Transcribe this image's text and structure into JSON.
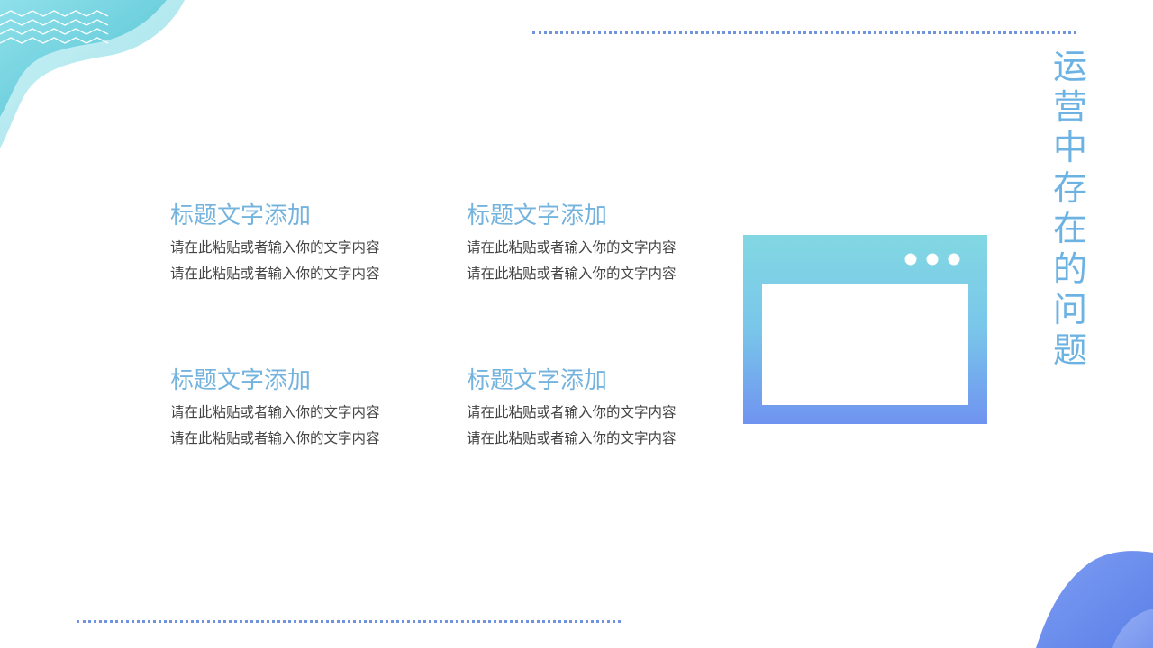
{
  "slide": {
    "vertical_title_chars": [
      "运",
      "营",
      "中",
      "存",
      "在",
      "的",
      "问",
      "题"
    ],
    "blocks": [
      {
        "title": "标题文字添加",
        "lines": [
          "请在此粘贴或者输入你的文字内容",
          "请在此粘贴或者输入你的文字内容"
        ]
      },
      {
        "title": "标题文字添加",
        "lines": [
          "请在此粘贴或者输入你的文字内容",
          "请在此粘贴或者输入你的文字内容"
        ]
      },
      {
        "title": "标题文字添加",
        "lines": [
          "请在此粘贴或者输入你的文字内容",
          "请在此粘贴或者输入你的文字内容"
        ]
      },
      {
        "title": "标题文字添加",
        "lines": [
          "请在此粘贴或者输入你的文字内容",
          "请在此粘贴或者输入你的文字内容"
        ]
      }
    ],
    "icon": "browser-window-icon",
    "colors": {
      "title_blue": "#74b3de",
      "vertical_title": "#6cb3e4",
      "body_text": "#444444",
      "dotted_line": "#6f93dd",
      "teal": "#7fd6e2",
      "periwinkle": "#6e8ff0"
    }
  }
}
